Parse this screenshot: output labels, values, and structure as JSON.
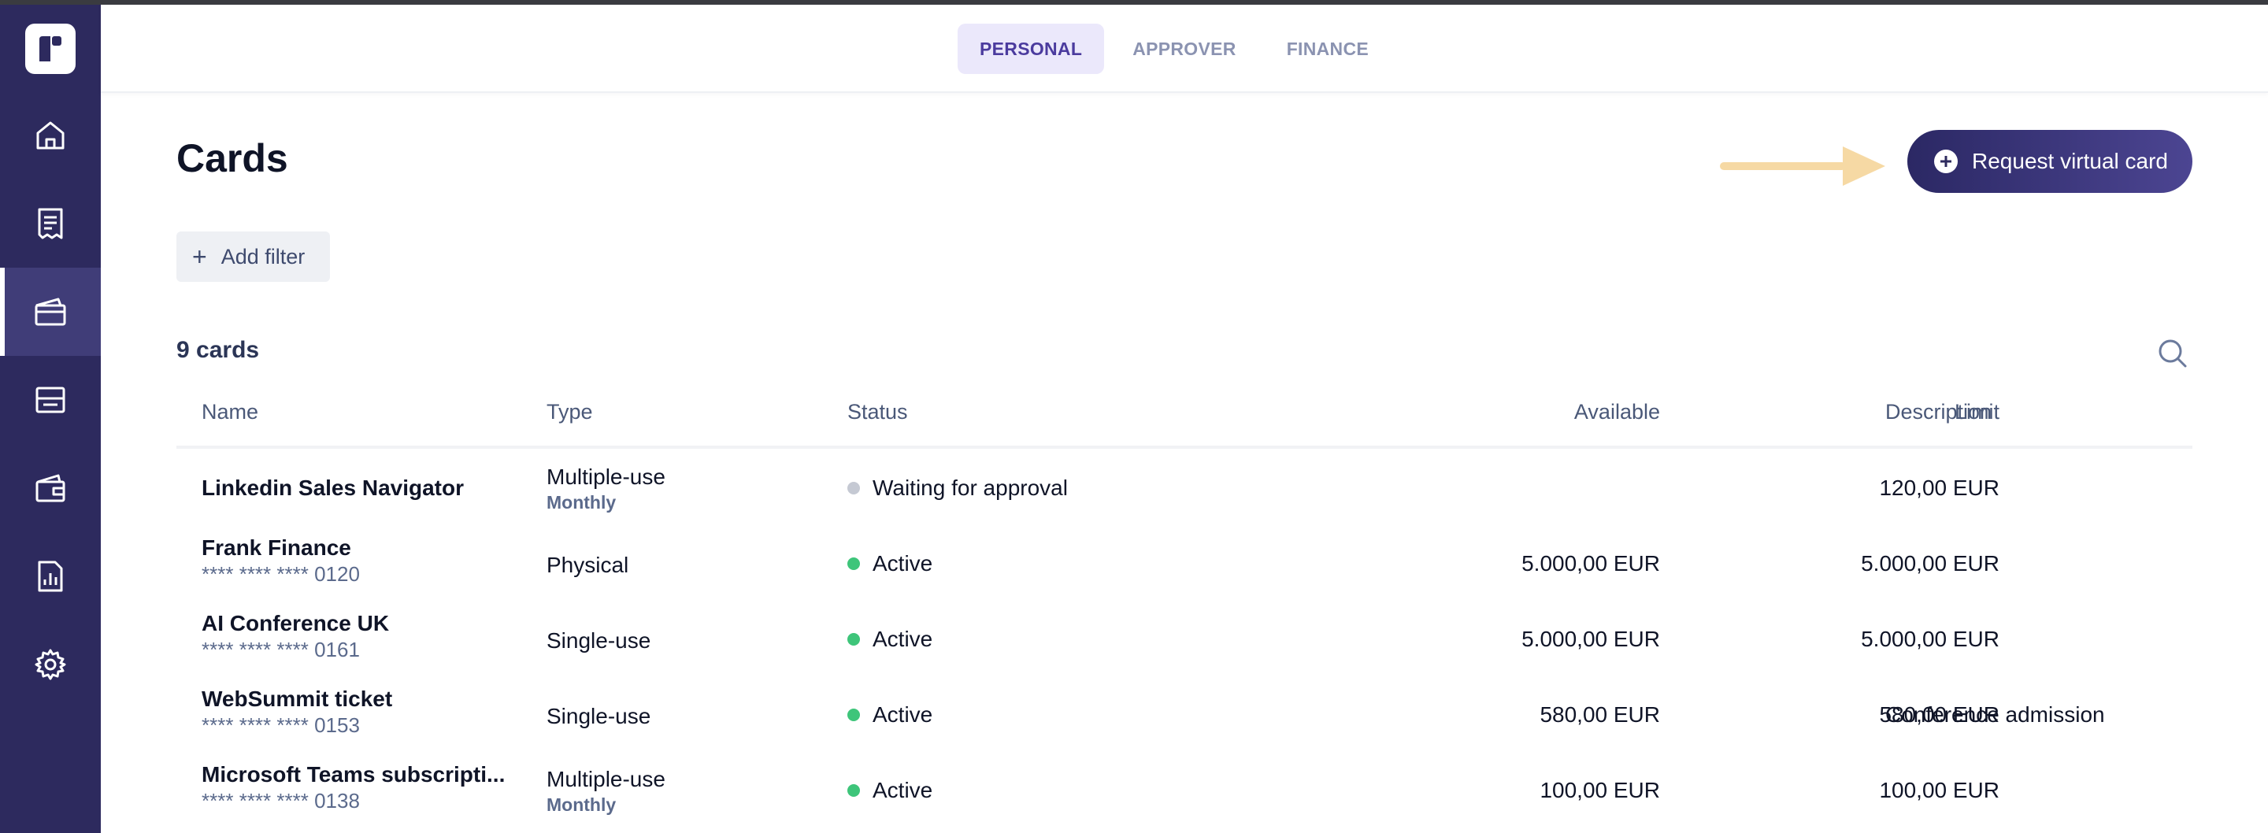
{
  "sidebar": {
    "items": [
      {
        "icon": "home-icon",
        "active": false
      },
      {
        "icon": "receipt-icon",
        "active": false
      },
      {
        "icon": "cards-icon",
        "active": true
      },
      {
        "icon": "card-reader-icon",
        "active": false
      },
      {
        "icon": "wallet-icon",
        "active": false
      },
      {
        "icon": "report-icon",
        "active": false
      },
      {
        "icon": "gear-icon",
        "active": false
      }
    ]
  },
  "tabs": [
    {
      "label": "PERSONAL",
      "active": true
    },
    {
      "label": "APPROVER",
      "active": false
    },
    {
      "label": "FINANCE",
      "active": false
    }
  ],
  "page": {
    "title": "Cards",
    "request_button": "Request virtual card",
    "add_filter": "Add filter",
    "count": "9 cards"
  },
  "table": {
    "headers": {
      "name": "Name",
      "type": "Type",
      "status": "Status",
      "available": "Available",
      "limit": "Limit",
      "description": "Description"
    },
    "rows": [
      {
        "name": "Linkedin Sales Navigator",
        "number": "",
        "type": "Multiple-use",
        "type_sub": "Monthly",
        "status": "Waiting for approval",
        "status_color": "#c5c9d3",
        "available": "",
        "limit": "120,00 EUR",
        "description": ""
      },
      {
        "name": "Frank Finance",
        "number": "**** **** **** 0120",
        "type": "Physical",
        "type_sub": "",
        "status": "Active",
        "status_color": "#3ec57a",
        "available": "5.000,00 EUR",
        "limit": "5.000,00 EUR",
        "description": ""
      },
      {
        "name": "AI Conference UK",
        "number": "**** **** **** 0161",
        "type": "Single-use",
        "type_sub": "",
        "status": "Active",
        "status_color": "#3ec57a",
        "available": "5.000,00 EUR",
        "limit": "5.000,00 EUR",
        "description": ""
      },
      {
        "name": "WebSummit ticket",
        "number": "**** **** **** 0153",
        "type": "Single-use",
        "type_sub": "",
        "status": "Active",
        "status_color": "#3ec57a",
        "available": "580,00 EUR",
        "limit": "580,00 EUR",
        "description": "Conference admission"
      },
      {
        "name": "Microsoft Teams subscripti...",
        "number": "**** **** **** 0138",
        "type": "Multiple-use",
        "type_sub": "Monthly",
        "status": "Active",
        "status_color": "#3ec57a",
        "available": "100,00 EUR",
        "limit": "100,00 EUR",
        "description": ""
      }
    ]
  },
  "colors": {
    "sidebar": "#2d2a5e",
    "accent": "#4b3b9e",
    "arrow": "#f6d9a4",
    "active_status": "#3ec57a",
    "pending_status": "#c5c9d3"
  }
}
